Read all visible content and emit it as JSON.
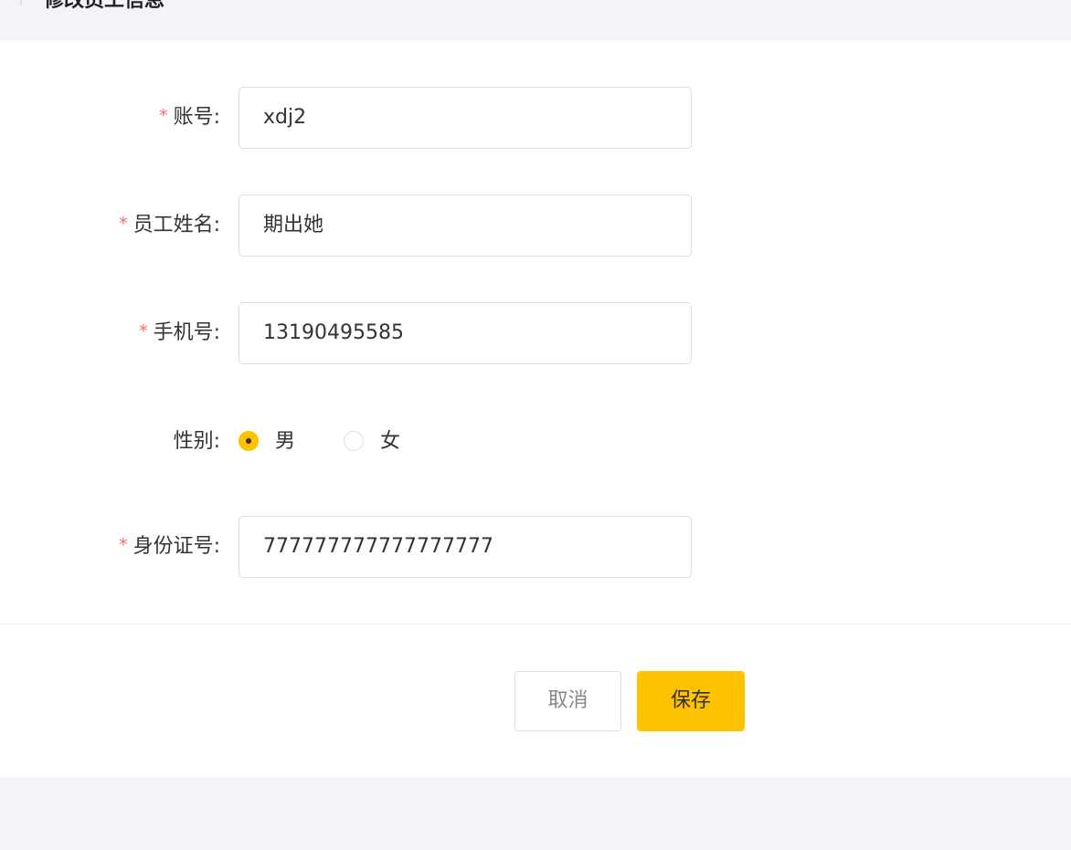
{
  "page": {
    "title": "修改员工信息"
  },
  "form": {
    "account": {
      "label": "账号:",
      "value": "xdj2",
      "required": "*"
    },
    "name": {
      "label": "员工姓名:",
      "value": "期出她",
      "required": "*"
    },
    "phone": {
      "label": "手机号:",
      "value": "13190495585",
      "required": "*"
    },
    "gender": {
      "label": "性别:",
      "options": [
        {
          "label": "男",
          "checked": true
        },
        {
          "label": "女",
          "checked": false
        }
      ]
    },
    "idNumber": {
      "label": "身份证号:",
      "value": "777777777777777777",
      "required": "*"
    }
  },
  "actions": {
    "cancel_label": "取消",
    "save_label": "保存"
  },
  "colors": {
    "accent": "#ffc200",
    "required": "#f56c6c",
    "background": "#f3f4f7"
  }
}
